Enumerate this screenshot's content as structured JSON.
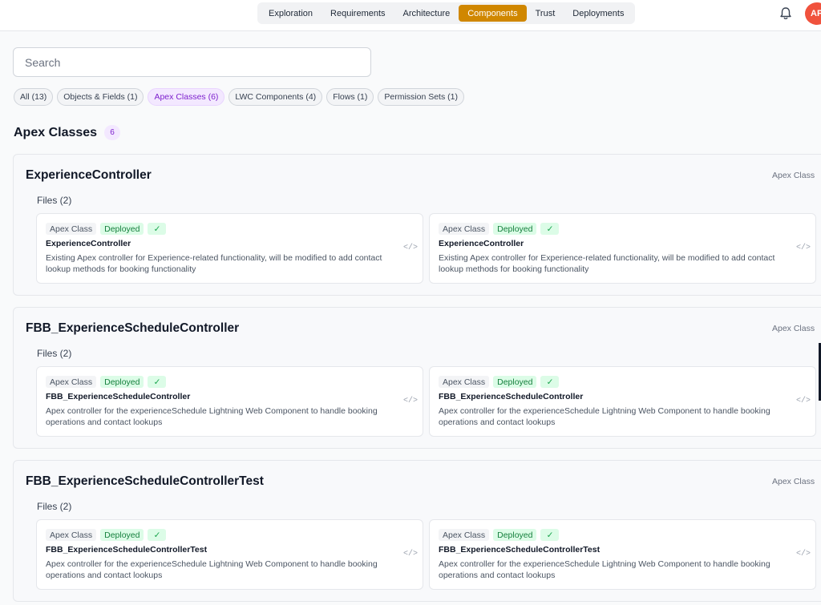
{
  "nav": {
    "tabs": [
      {
        "label": "Exploration",
        "active": false
      },
      {
        "label": "Requirements",
        "active": false
      },
      {
        "label": "Architecture",
        "active": false
      },
      {
        "label": "Components",
        "active": true
      },
      {
        "label": "Trust",
        "active": false
      },
      {
        "label": "Deployments",
        "active": false
      }
    ],
    "accent_color": "#d08700"
  },
  "header": {
    "bell_icon": "bell-icon",
    "avatar_initials": "AP",
    "avatar_color": "#f0523d"
  },
  "search": {
    "placeholder": "Search",
    "value": ""
  },
  "filters": [
    {
      "label": "All (13)",
      "active": false
    },
    {
      "label": "Objects & Fields (1)",
      "active": false
    },
    {
      "label": "Apex Classes (6)",
      "active": true
    },
    {
      "label": "LWC Components (4)",
      "active": false
    },
    {
      "label": "Flows (1)",
      "active": false
    },
    {
      "label": "Permission Sets (1)",
      "active": false
    }
  ],
  "section": {
    "title": "Apex Classes",
    "count": "6"
  },
  "groups": [
    {
      "title": "ExperienceController",
      "type": "Apex Class",
      "files_label": "Files (2)",
      "cards": [
        {
          "type": "Apex Class",
          "status": "Deployed",
          "name": "ExperienceController",
          "description": "Existing Apex controller for Experience-related functionality, will be modified to add contact lookup methods for booking functionality"
        },
        {
          "type": "Apex Class",
          "status": "Deployed",
          "name": "ExperienceController",
          "description": "Existing Apex controller for Experience-related functionality, will be modified to add contact lookup methods for booking functionality"
        }
      ]
    },
    {
      "title": "FBB_ExperienceScheduleController",
      "type": "Apex Class",
      "files_label": "Files (2)",
      "cards": [
        {
          "type": "Apex Class",
          "status": "Deployed",
          "name": "FBB_ExperienceScheduleController",
          "description": "Apex controller for the experienceSchedule Lightning Web Component to handle booking operations and contact lookups"
        },
        {
          "type": "Apex Class",
          "status": "Deployed",
          "name": "FBB_ExperienceScheduleController",
          "description": "Apex controller for the experienceSchedule Lightning Web Component to handle booking operations and contact lookups"
        }
      ]
    },
    {
      "title": "FBB_ExperienceScheduleControllerTest",
      "type": "Apex Class",
      "files_label": "Files (2)",
      "cards": [
        {
          "type": "Apex Class",
          "status": "Deployed",
          "name": "FBB_ExperienceScheduleControllerTest",
          "description": "Apex controller for the experienceSchedule Lightning Web Component to handle booking operations and contact lookups"
        },
        {
          "type": "Apex Class",
          "status": "Deployed",
          "name": "FBB_ExperienceScheduleControllerTest",
          "description": "Apex controller for the experienceSchedule Lightning Web Component to handle booking operations and contact lookups"
        }
      ]
    }
  ],
  "code_icon_glyph": "</>",
  "check_icon_glyph": "✓"
}
